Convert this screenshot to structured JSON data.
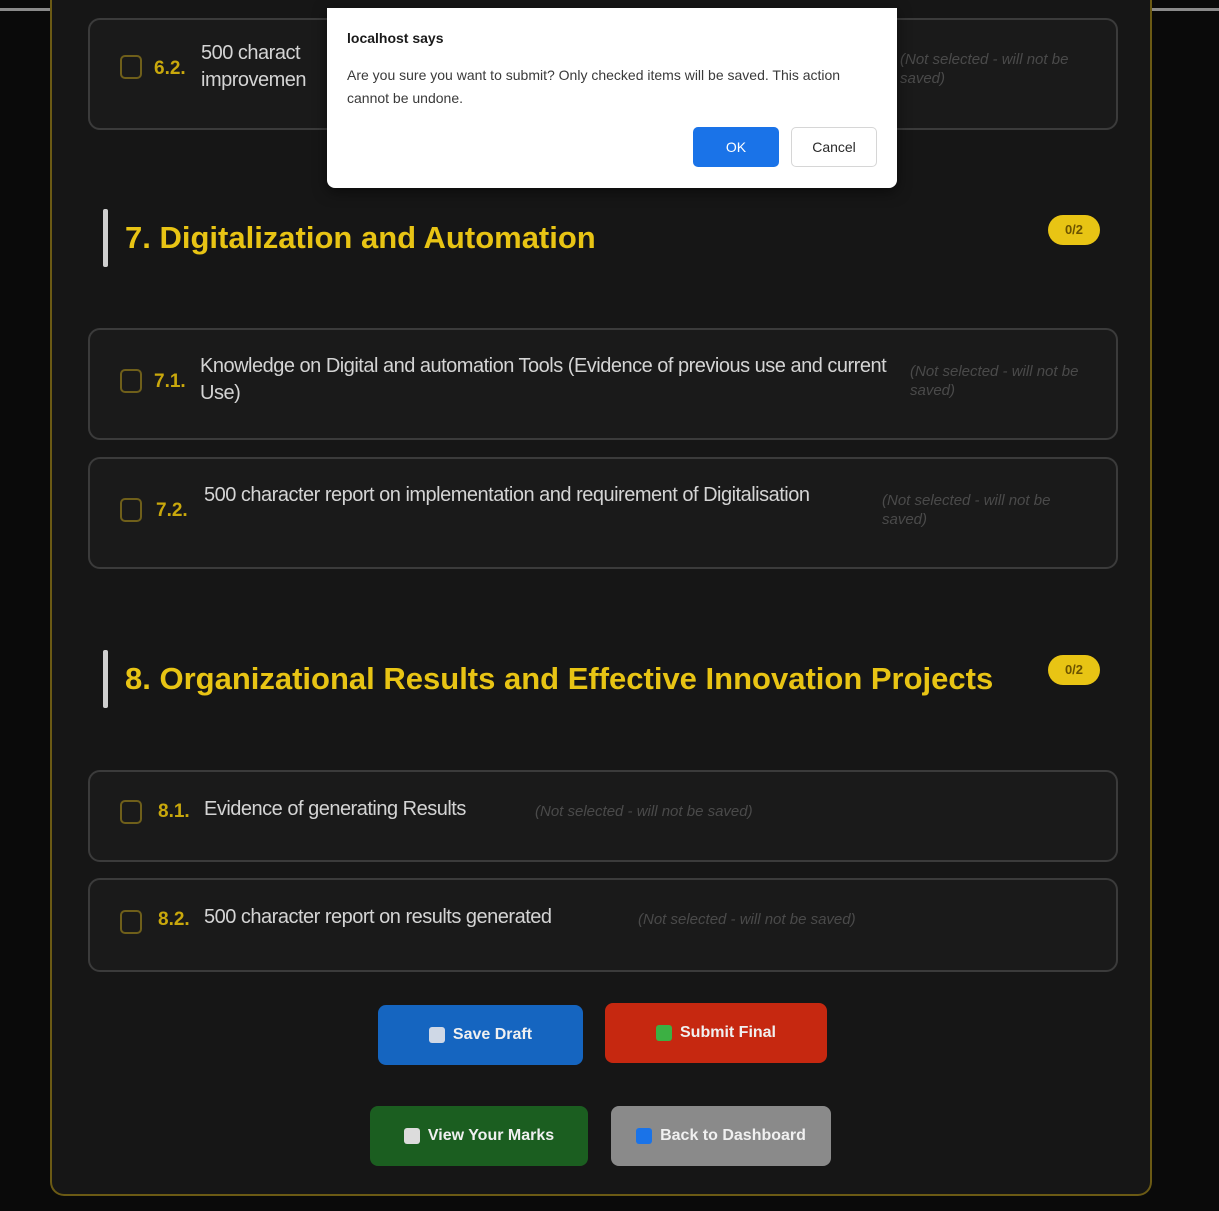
{
  "dialog": {
    "title": "localhost says",
    "message": "Are you sure you want to submit? Only checked items will be saved. This action cannot be undone.",
    "ok_label": "OK",
    "cancel_label": "Cancel"
  },
  "section6": {
    "items": [
      {
        "number": "6.2.",
        "text": "500 charact",
        "text_line2": "improvemen",
        "status": "(Not selected - will not be saved)"
      }
    ]
  },
  "section7": {
    "title": "7. Digitalization and Automation",
    "badge": "0/2",
    "items": [
      {
        "number": "7.1.",
        "text": "Knowledge on Digital and automation Tools (Evidence of previous use and current Use)",
        "status": "(Not selected - will not be saved)"
      },
      {
        "number": "7.2.",
        "text": "500 character report on implementation and requirement of Digitalisation",
        "status": "(Not selected - will not be saved)"
      }
    ]
  },
  "section8": {
    "title": "8. Organizational Results and Effective Innovation Projects",
    "badge": "0/2",
    "items": [
      {
        "number": "8.1.",
        "text": "Evidence of generating Results",
        "status": "(Not selected - will not be saved)"
      },
      {
        "number": "8.2.",
        "text": "500 character report on results generated",
        "status": "(Not selected - will not be saved)"
      }
    ]
  },
  "actions": {
    "save_draft": "Save Draft",
    "submit_final": "Submit Final",
    "view_marks": "View Your Marks",
    "back_dashboard": "Back to Dashboard"
  },
  "colors": {
    "accent": "#e8c414",
    "save": "#1565c0",
    "submit": "#c62810",
    "marks": "#1b5e20",
    "back": "#8a8a8a",
    "ok": "#1a73e8"
  },
  "icons": {
    "save": "floppy-disk-icon",
    "submit": "check-mark-icon",
    "marks": "document-icon",
    "back": "arrow-back-icon"
  }
}
